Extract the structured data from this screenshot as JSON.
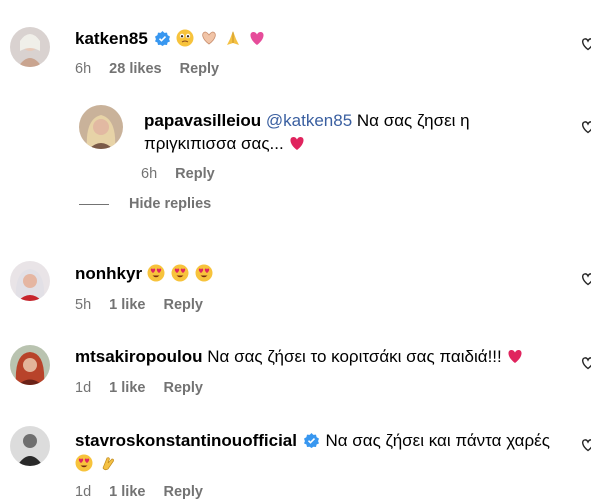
{
  "comments": [
    {
      "username": "katken85",
      "verified": true,
      "text": "",
      "emojis": [
        "🥹",
        "🫶",
        "🙏",
        "💗"
      ],
      "time": "6h",
      "likes": "28 likes",
      "reply_label": "Reply"
    },
    {
      "username": "papavasilleiou",
      "verified": false,
      "mention": "@katken85",
      "text_line1": "Να σας ζησει η",
      "text_line2": "πριγκιπισσα σας...",
      "emojis": [
        "❤️"
      ],
      "time": "6h",
      "reply_label": "Reply"
    },
    {
      "username": "nonhkyr",
      "verified": false,
      "text": "",
      "emojis": [
        "😍",
        "😍",
        "😍"
      ],
      "time": "5h",
      "likes": "1 like",
      "reply_label": "Reply"
    },
    {
      "username": "mtsakiropoulou",
      "verified": false,
      "text": "Να σας ζήσει το κοριτσάκι σας παιδιά!!!",
      "emojis": [
        "❤️"
      ],
      "time": "1d",
      "likes": "1 like",
      "reply_label": "Reply"
    },
    {
      "username": "stavroskonstantinouofficial",
      "verified": true,
      "text": "Να σας ζήσει και πάντα χαρές",
      "emojis": [
        "😍",
        "👏"
      ],
      "time": "1d",
      "likes": "1 like",
      "reply_label": "Reply"
    }
  ],
  "hide_replies_label": "Hide replies",
  "colors": {
    "verified": "#3897f0",
    "meta": "#737373",
    "mention": "#3a5fa0"
  },
  "icons": [
    "verified-badge-icon",
    "heart-outline-icon"
  ]
}
